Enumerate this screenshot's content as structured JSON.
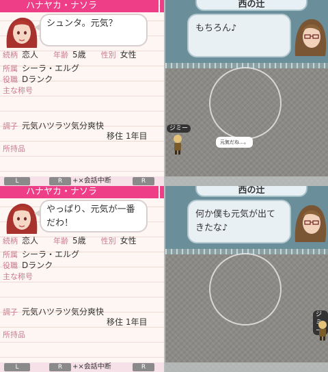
{
  "frames": [
    {
      "character_name": "ハナヤカ・ナソラ",
      "speech": "シュンタ。元気？",
      "profile": {
        "relation_label": "続柄",
        "relation_value": "恋人",
        "age_label": "年齢",
        "age_value": "5歳",
        "gender_label": "性別",
        "gender_value": "女性",
        "affiliation_label": "所属",
        "affiliation_value": "シーラ・エルグ",
        "role_label": "役職",
        "role_value": "Dランク",
        "titles_label": "主な称号",
        "condition_label": "調子",
        "condition_value": "元気ハツラツ気分爽快",
        "residence_value": "移住 1年目",
        "items_label": "所持品"
      },
      "buttons": {
        "l": "L",
        "r": "R",
        "cancel": "+×会話中断",
        "r2": "R"
      },
      "map": {
        "place": "西の辻",
        "dialog": "もちろん♪",
        "npc_tag": "ジミー",
        "small_bubble": "元気だね…。"
      }
    },
    {
      "character_name": "ハナヤカ・ナソラ",
      "speech": "やっぱり、元気が一番だわ！",
      "profile": {
        "relation_label": "続柄",
        "relation_value": "恋人",
        "age_label": "年齢",
        "age_value": "5歳",
        "gender_label": "性別",
        "gender_value": "女性",
        "affiliation_label": "所属",
        "affiliation_value": "シーラ・エルグ",
        "role_label": "役職",
        "role_value": "Dランク",
        "titles_label": "主な称号",
        "condition_label": "調子",
        "condition_value": "元気ハツラツ気分爽快",
        "residence_value": "移住 1年目",
        "items_label": "所持品"
      },
      "buttons": {
        "l": "L",
        "r": "R",
        "cancel": "+×会話中断",
        "r2": "R"
      },
      "map": {
        "place": "西の辻",
        "dialog": "何か僕も元気が出てきたな♪",
        "npc_tag": "ジミー"
      }
    }
  ],
  "colors": {
    "accent": "#ee3e88",
    "label": "#c97a8e"
  }
}
